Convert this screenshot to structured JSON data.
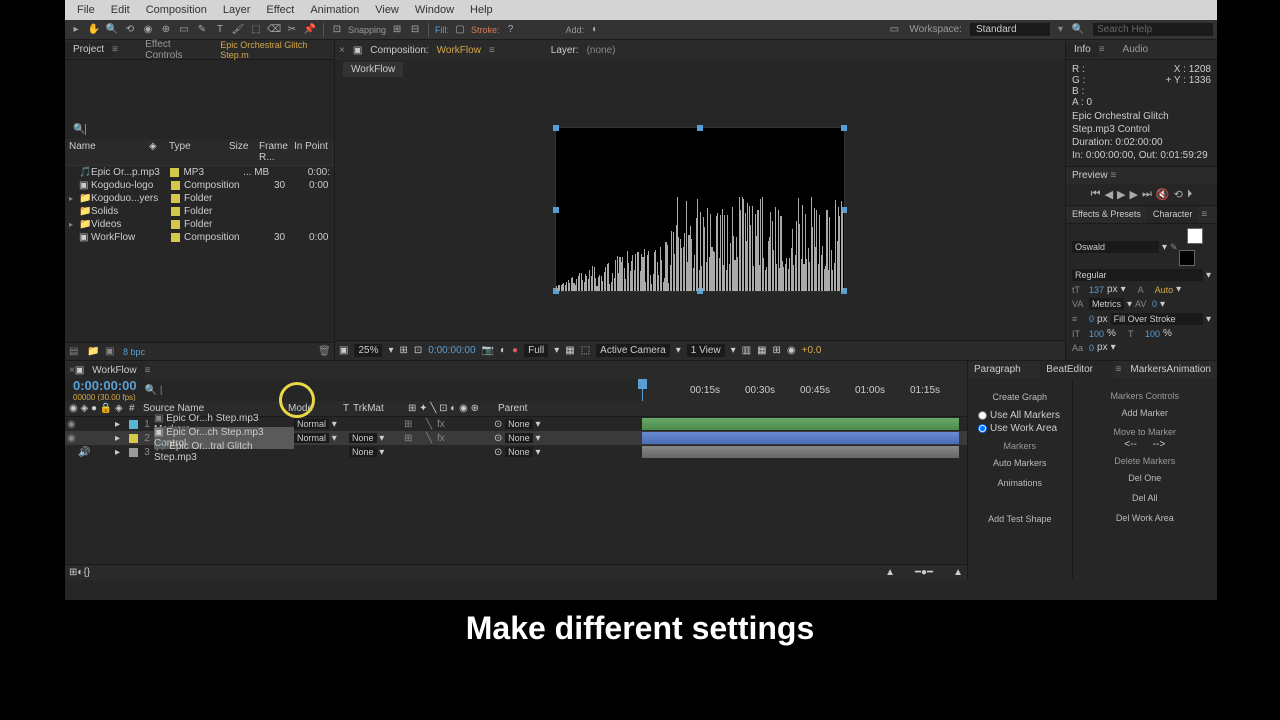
{
  "menu": {
    "file": "File",
    "edit": "Edit",
    "composition": "Composition",
    "layer": "Layer",
    "effect": "Effect",
    "animation": "Animation",
    "view": "View",
    "window": "Window",
    "help": "Help"
  },
  "toolbar": {
    "snapping": "Snapping",
    "fill": "Fill:",
    "stroke": "Stroke:",
    "add": "Add:",
    "workspace_lbl": "Workspace:",
    "workspace": "Standard",
    "search": "Search Help"
  },
  "project": {
    "tab": "Project",
    "effects_tab": "Effect Controls",
    "effects_sub": "Epic Orchestral Glitch Step.m",
    "cols": {
      "name": "Name",
      "type": "Type",
      "size": "Size",
      "frame": "Frame R...",
      "in": "In Point"
    },
    "items": [
      {
        "name": "Epic Or...p.mp3",
        "type": "MP3",
        "size": "... MB",
        "fr": "",
        "in": "0:00:"
      },
      {
        "name": "Kogoduo-logo",
        "type": "Composition",
        "size": "",
        "fr": "30",
        "in": "0:00"
      },
      {
        "name": "Kogoduo...yers",
        "type": "Folder",
        "size": "",
        "fr": "",
        "in": ""
      },
      {
        "name": "Solids",
        "type": "Folder",
        "size": "",
        "fr": "",
        "in": ""
      },
      {
        "name": "Videos",
        "type": "Folder",
        "size": "",
        "fr": "",
        "in": ""
      },
      {
        "name": "WorkFlow",
        "type": "Composition",
        "size": "",
        "fr": "30",
        "in": "0:00"
      }
    ],
    "bpc": "8 bpc"
  },
  "comp": {
    "label": "Composition:",
    "name": "WorkFlow",
    "layer": "Layer:",
    "layer_val": "(none)",
    "flow_tab": "WorkFlow",
    "zoom": "25%",
    "time": "0:00:00:00",
    "res": "Full",
    "camera": "Active Camera",
    "view": "1 View",
    "meta": "+0.0"
  },
  "info": {
    "tab": "Info",
    "audio_tab": "Audio",
    "r": "R :",
    "g": "G :",
    "b": "B :",
    "a": "A : 0",
    "x": "X : 1208",
    "y": "Y : 1336",
    "cross": "+",
    "desc1": "Epic Orchestral Glitch Step.mp3 Control",
    "desc2": "Duration: 0:02:00:00",
    "desc3": "In: 0:00:00:00, Out: 0:01:59:29"
  },
  "preview": {
    "tab": "Preview"
  },
  "ep": {
    "effects": "Effects & Presets",
    "character": "Character"
  },
  "char": {
    "font": "Oswald",
    "style": "Regular",
    "size": "137",
    "size_u": "px",
    "auto": "Auto",
    "metrics": "Metrics",
    "zero": "0",
    "px": "px",
    "fill": "Fill Over Stroke",
    "hundred": "100",
    "pct": "%"
  },
  "timeline": {
    "tab": "WorkFlow",
    "time": "0:00:00:00",
    "fps": "00000 (30.00 fps)",
    "cols": {
      "source": "Source Name",
      "mode": "Mode",
      "trkmat": "TrkMat",
      "parent": "Parent"
    },
    "ruler": [
      "00:15s",
      "00:30s",
      "00:45s",
      "01:00s",
      "01:15s"
    ],
    "layers": [
      {
        "num": "1",
        "name": "Epic Or...h Step.mp3 Markers",
        "mode": "Normal",
        "trk": "",
        "parent": "None"
      },
      {
        "num": "2",
        "name": "Epic Or...ch Step.mp3 Control",
        "mode": "Normal",
        "trk": "None",
        "parent": "None"
      },
      {
        "num": "3",
        "name": "Epic Or...tral Glitch Step.mp3",
        "mode": "",
        "trk": "None",
        "parent": "None"
      }
    ]
  },
  "beat": {
    "para": "Paragraph",
    "tab": "BeatEditor",
    "markers_anim": "MarkersAnimation",
    "create": "Create Graph",
    "use_all": "Use All Markers",
    "use_work": "Use Work Area",
    "markers": "Markers",
    "auto": "Auto Markers",
    "anim": "Animations",
    "test": "Add Test Shape"
  },
  "mc": {
    "head": "Markers Controls",
    "add": "Add Marker",
    "move": "Move to Marker",
    "left": "<--",
    "right": "-->",
    "del_head": "Delete Markers",
    "del_one": "Del One",
    "del_all": "Del All",
    "del_work": "Del Work Area"
  },
  "caption": "Make different settings"
}
